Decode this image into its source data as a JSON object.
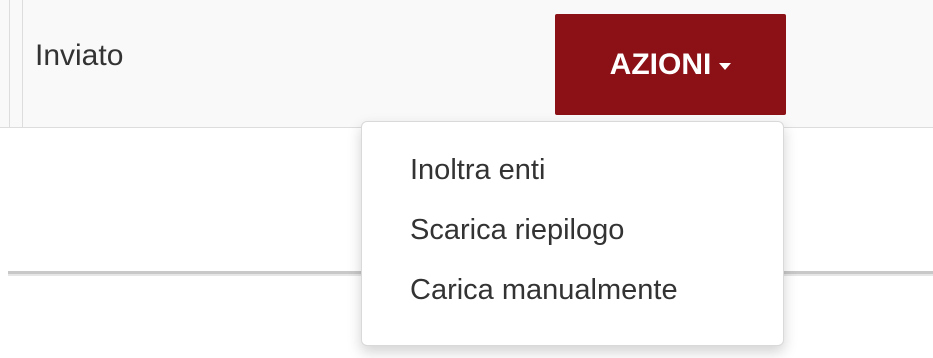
{
  "table": {
    "row": {
      "status": "Inviato"
    }
  },
  "actions": {
    "button_label": "AZIONI",
    "caret_icon": "caret-down-icon",
    "button_color": "#8b1116",
    "menu_items": [
      {
        "label": "Inoltra enti"
      },
      {
        "label": "Scarica riepilogo"
      },
      {
        "label": "Carica manualmente"
      }
    ]
  }
}
